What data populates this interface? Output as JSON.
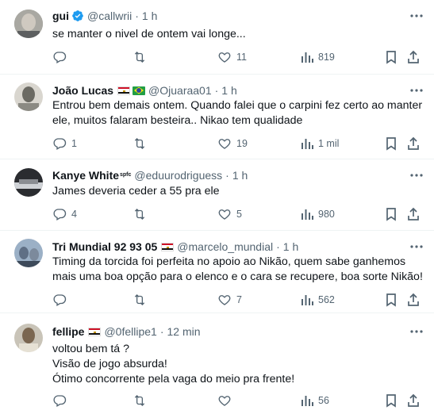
{
  "colors": {
    "text": "#0f1419",
    "muted": "#536471",
    "verified": "#1d9bf0",
    "divider": "#eff3f4"
  },
  "icons": {
    "reply": "reply-icon",
    "retweet": "retweet-icon",
    "like": "heart-icon",
    "views": "views-icon",
    "bookmark": "bookmark-icon",
    "share": "share-icon",
    "more": "more-icon"
  },
  "tweets": [
    {
      "name": "gui",
      "handle": "@callwrii",
      "dot": "·",
      "time": "1 h",
      "text": "se manter o nivel de ontem vai longe...",
      "replies": "",
      "retweets": "",
      "likes": "11",
      "views": "819"
    },
    {
      "name": "João Lucas",
      "handle": "@Ojuaraa01",
      "dot": "·",
      "time": "1 h",
      "text": "Entrou bem demais ontem. Quando falei que o carpini fez certo ao manter ele, muitos falaram besteira.. Nikao tem qualidade",
      "replies": "1",
      "retweets": "",
      "likes": "19",
      "views": "1 mil"
    },
    {
      "name": "Kanye White",
      "name_suffix": "spfc",
      "handle": "@eduurodriguess",
      "dot": "·",
      "time": "1 h",
      "text": "James deveria ceder a 55 pra ele",
      "replies": "4",
      "retweets": "",
      "likes": "5",
      "views": "980"
    },
    {
      "name": "Tri Mundial 92 93 05",
      "handle": "@marcelo_mundial",
      "dot": "·",
      "time": "1 h",
      "text": "Timing da torcida foi perfeita no apoio ao Nikão, quem sabe ganhemos mais uma boa opção para o elenco e o cara se recupere, boa sorte Nikão!",
      "replies": "",
      "retweets": "",
      "likes": "7",
      "views": "562"
    },
    {
      "name": "fellipe",
      "handle": "@0fellipe1",
      "dot": "·",
      "time": "12 min",
      "text": "voltou bem tá ?\nVisão de jogo absurda!\nÓtimo concorrente pela vaga do meio pra frente!",
      "replies": "",
      "retweets": "",
      "likes": "",
      "views": "56"
    }
  ]
}
